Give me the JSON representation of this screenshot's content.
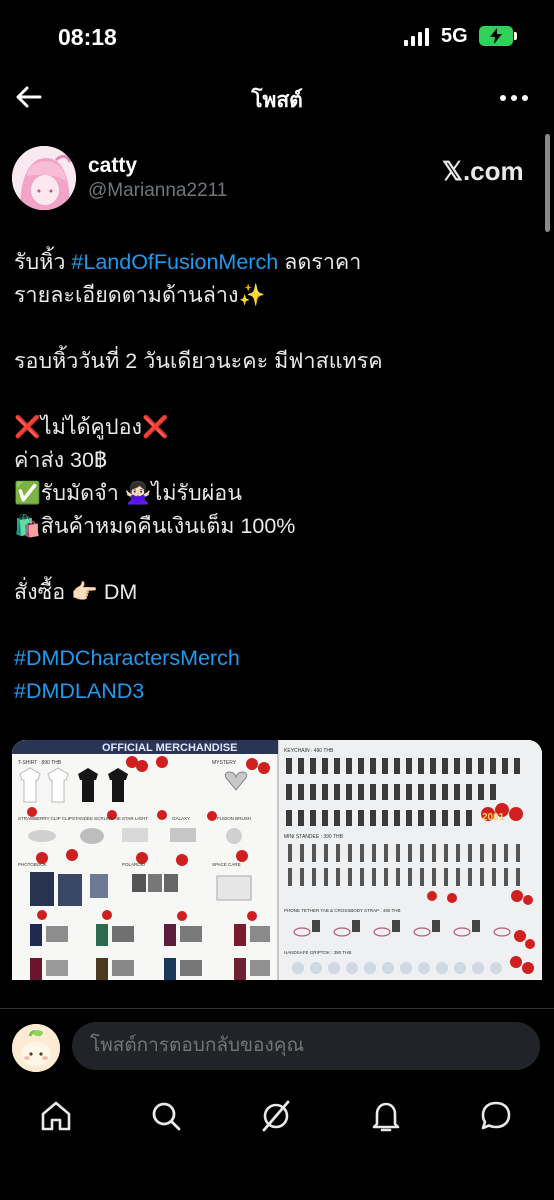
{
  "status": {
    "time": "08:18",
    "network": "5G"
  },
  "header": {
    "title": "โพสต์"
  },
  "author": {
    "name": "catty",
    "handle": "@Marianna2211",
    "source_label": "𝕏.com"
  },
  "post": {
    "l1_pre": "รับหิ้ว ",
    "l1_tag": "#LandOfFusionMerch",
    "l1_post": " ลดราคา",
    "l2": "รายละเอียดตามด้านล่าง✨",
    "l3": "รอบหิ้ววันที่ 2 วันเดียวนะคะ มีฟาสแทรค",
    "l4_x1": "❌",
    "l4_text": "ไม่ได้คูปอง",
    "l4_x2": "❌",
    "l5": "ค่าส่ง 30฿",
    "l6": "✅รับมัดจำ 🙅🏻‍♀️ไม่รับผ่อน",
    "l7": "🛍️สินค้าหมดคืนเงินเต็ม 100%",
    "l8": "สั่งซื้อ 👉🏻 DM",
    "tag1": "#DMDCharactersMerch",
    "tag2": "#DMDLAND3"
  },
  "merch_image": {
    "banner": "OFFICIAL MERCHANDISE",
    "left_labels": [
      "T-SHIRT : 890 THB",
      "MYSTERY",
      "STRAWBERRY CLIP CLIP",
      "STANDEE SCRUNCHIE",
      "STAR LIGHT",
      "GALAXY",
      "FUSION BRUSH",
      "PHOTOBOOK",
      "POLAROID",
      "SPACE CARE"
    ],
    "right_labels": [
      "KEYCHAIN : 490 THB",
      "MINI STANDEE : 390 THB",
      "PHONE TETHER TAB & CROSSBODY STRAP : 490 THB",
      "HANDSAFE GRIPTOK : 390 THB"
    ],
    "sale_tag": "2001"
  },
  "reply": {
    "placeholder": "โพสต์การตอบกลับของคุณ"
  },
  "colors": {
    "accent": "#1d9bf0",
    "background": "#000000",
    "muted": "#71767b"
  },
  "icons": [
    "home-icon",
    "search-icon",
    "grok-icon",
    "notifications-icon",
    "messages-icon"
  ]
}
